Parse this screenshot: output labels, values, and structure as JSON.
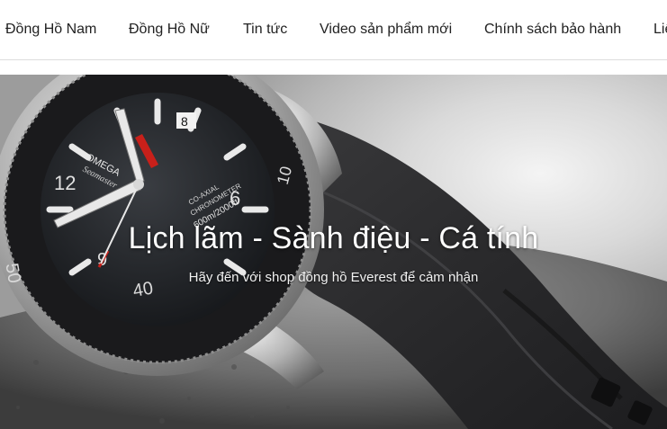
{
  "nav": {
    "items": [
      {
        "label": "Đồng Hồ Nam"
      },
      {
        "label": "Đồng Hồ Nữ"
      },
      {
        "label": "Tin tức"
      },
      {
        "label": "Video sản phẩm mới"
      },
      {
        "label": "Chính sách bảo hành"
      },
      {
        "label": "Liên hệ"
      }
    ]
  },
  "hero": {
    "title": "Lịch lãm - Sành điệu - Cá tính",
    "subtitle": "Hãy đến với shop đồng hồ Everest để cảm nhận",
    "watch_markings": {
      "brand": "OMEGA",
      "line": "Seamaster",
      "coaxial": "CO-AXIAL",
      "chronometer": "CHRONOMETER",
      "depth": "600m/2000ft",
      "numerals": [
        "12",
        "9",
        "6"
      ],
      "date": "8",
      "bezel": [
        "50",
        "40",
        "10"
      ]
    },
    "colors": {
      "title": "#ffffff",
      "accent_red": "#c8201a"
    }
  }
}
